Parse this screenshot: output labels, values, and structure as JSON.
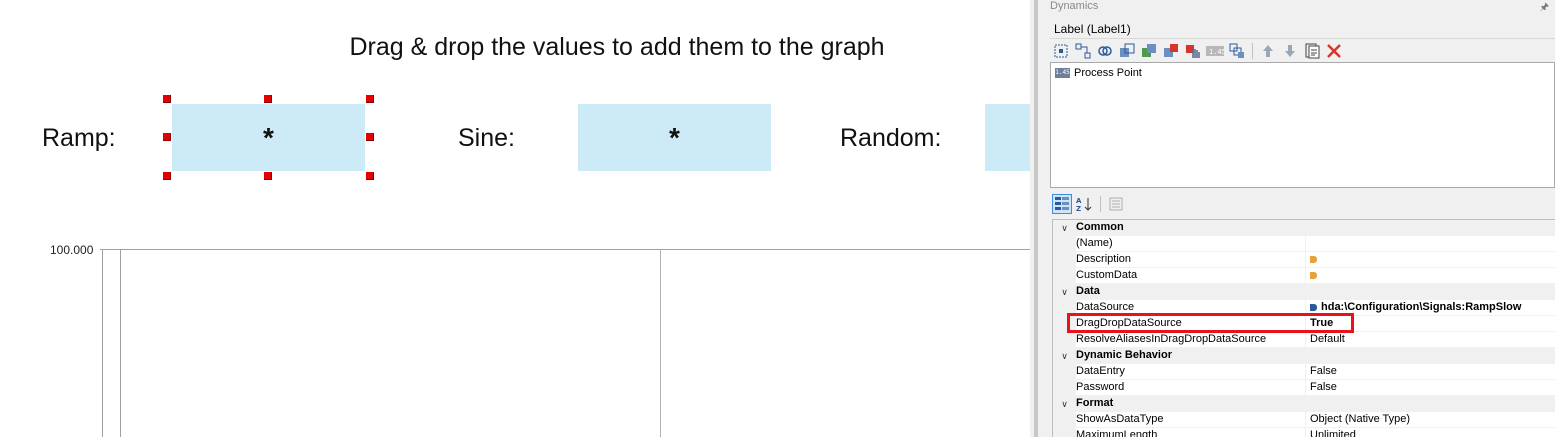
{
  "canvas": {
    "instruction": "Drag & drop the values to add them to the graph",
    "fields": [
      {
        "label": "Ramp:",
        "value": "*"
      },
      {
        "label": "Sine:",
        "value": "*"
      },
      {
        "label": "Random:",
        "value": ""
      }
    ],
    "chart": {
      "y_tick_label": "100.000"
    }
  },
  "panel": {
    "header": "Dynamics",
    "pin_icon": "pin-icon",
    "object_title": "Label (Label1)",
    "toolbar_icons": [
      "select-all-icon",
      "connect-icon",
      "link-icon",
      "copy-dynamic-icon",
      "paste-dynamic-icon",
      "remove-dynamic-icon",
      "hand-icon",
      "text-box-icon",
      "group-icon",
      "move-up-icon",
      "move-down-icon",
      "properties-icon",
      "delete-icon"
    ],
    "dynamics_list": [
      {
        "icon_text": "1.45",
        "label": "Process Point"
      }
    ],
    "property_view_buttons": [
      "categorized-icon",
      "alphabetical-icon",
      "property-pages-icon"
    ],
    "categories": [
      {
        "name": "Common",
        "rows": [
          {
            "name": "(Name)",
            "value": ""
          },
          {
            "name": "Description",
            "value": ""
          },
          {
            "name": "CustomData",
            "value": ""
          }
        ]
      },
      {
        "name": "Data",
        "rows": [
          {
            "name": "DataSource",
            "value": "hda:\\Configuration\\Signals:RampSlow"
          },
          {
            "name": "DragDropDataSource",
            "value": "True"
          },
          {
            "name": "ResolveAliasesInDragDropDataSource",
            "value": "Default"
          }
        ]
      },
      {
        "name": "Dynamic Behavior",
        "rows": [
          {
            "name": "DataEntry",
            "value": "False"
          },
          {
            "name": "Password",
            "value": "False"
          }
        ]
      },
      {
        "name": "Format",
        "rows": [
          {
            "name": "ShowAsDataType",
            "value": "Object (Native Type)"
          },
          {
            "name": "MaximumLength",
            "value": "Unlimited"
          }
        ]
      }
    ],
    "colors": {
      "highlight": "#e8111c",
      "value_box": "#cdebf7",
      "handle": "#e30000"
    }
  }
}
